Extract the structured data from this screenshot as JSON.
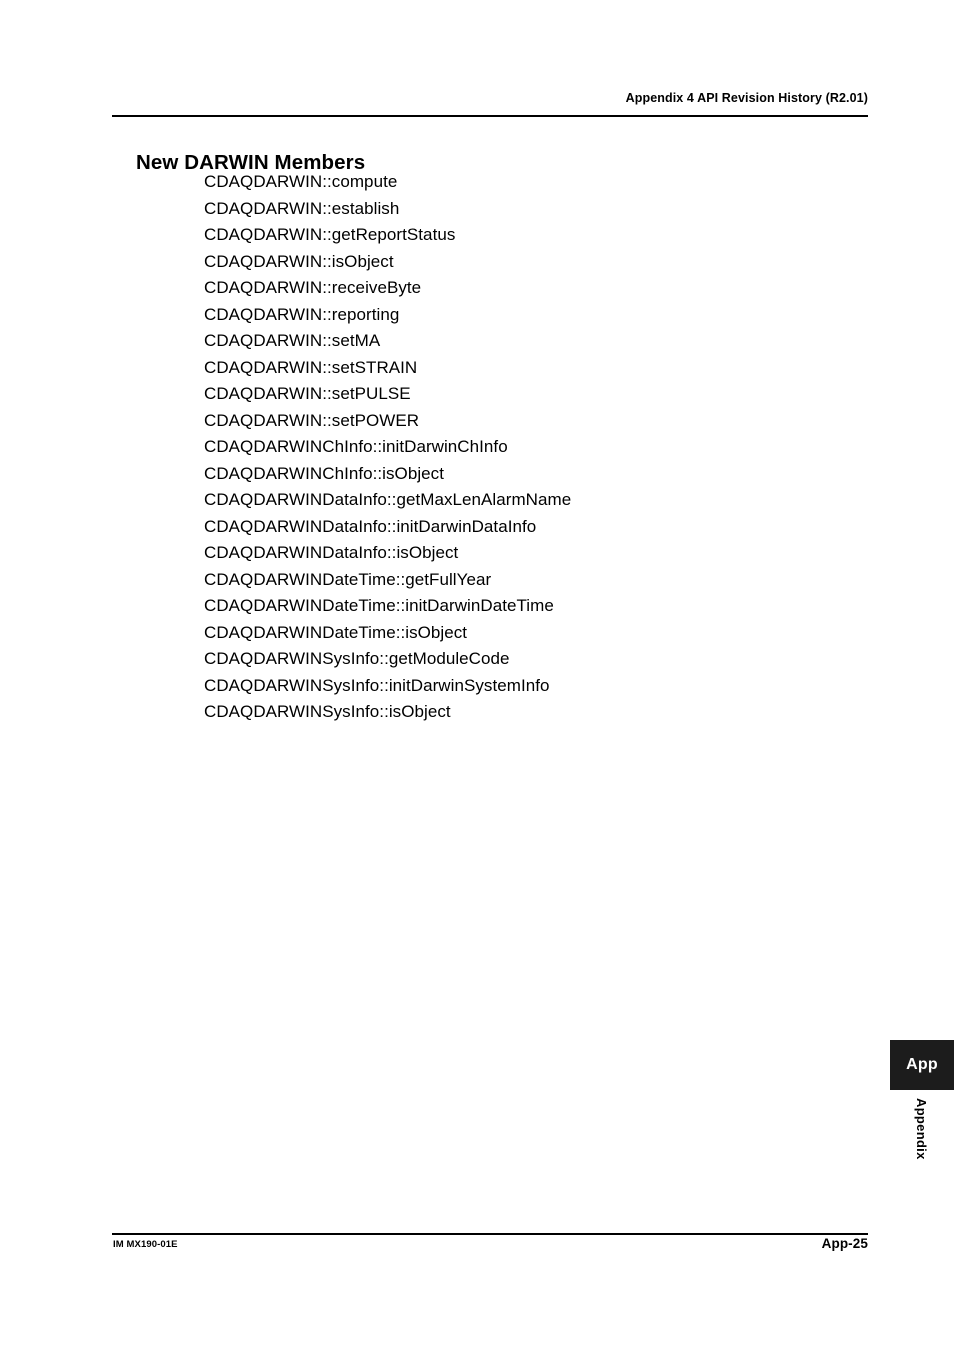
{
  "header": {
    "running_head": "Appendix 4  API Revision History (R2.01)"
  },
  "section": {
    "title": "New DARWIN Members"
  },
  "members": [
    "CDAQDARWIN::compute",
    "CDAQDARWIN::establish",
    "CDAQDARWIN::getReportStatus",
    "CDAQDARWIN::isObject",
    "CDAQDARWIN::receiveByte",
    "CDAQDARWIN::reporting",
    "CDAQDARWIN::setMA",
    "CDAQDARWIN::setSTRAIN",
    "CDAQDARWIN::setPULSE",
    "CDAQDARWIN::setPOWER",
    "CDAQDARWINChInfo::initDarwinChInfo",
    "CDAQDARWINChInfo::isObject",
    "CDAQDARWINDataInfo::getMaxLenAlarmName",
    "CDAQDARWINDataInfo::initDarwinDataInfo",
    "CDAQDARWINDataInfo::isObject",
    "CDAQDARWINDateTime::getFullYear",
    "CDAQDARWINDateTime::initDarwinDateTime",
    "CDAQDARWINDateTime::isObject",
    "CDAQDARWINSysInfo::getModuleCode",
    "CDAQDARWINSysInfo::initDarwinSystemInfo",
    "CDAQDARWINSysInfo::isObject"
  ],
  "side_tab": {
    "badge": "App",
    "label": "Appendix",
    "badge_bg": "#1c1c1c",
    "badge_fg": "#ffffff"
  },
  "footer": {
    "document_code": "IM MX190-01E",
    "page_number": "App-25"
  }
}
